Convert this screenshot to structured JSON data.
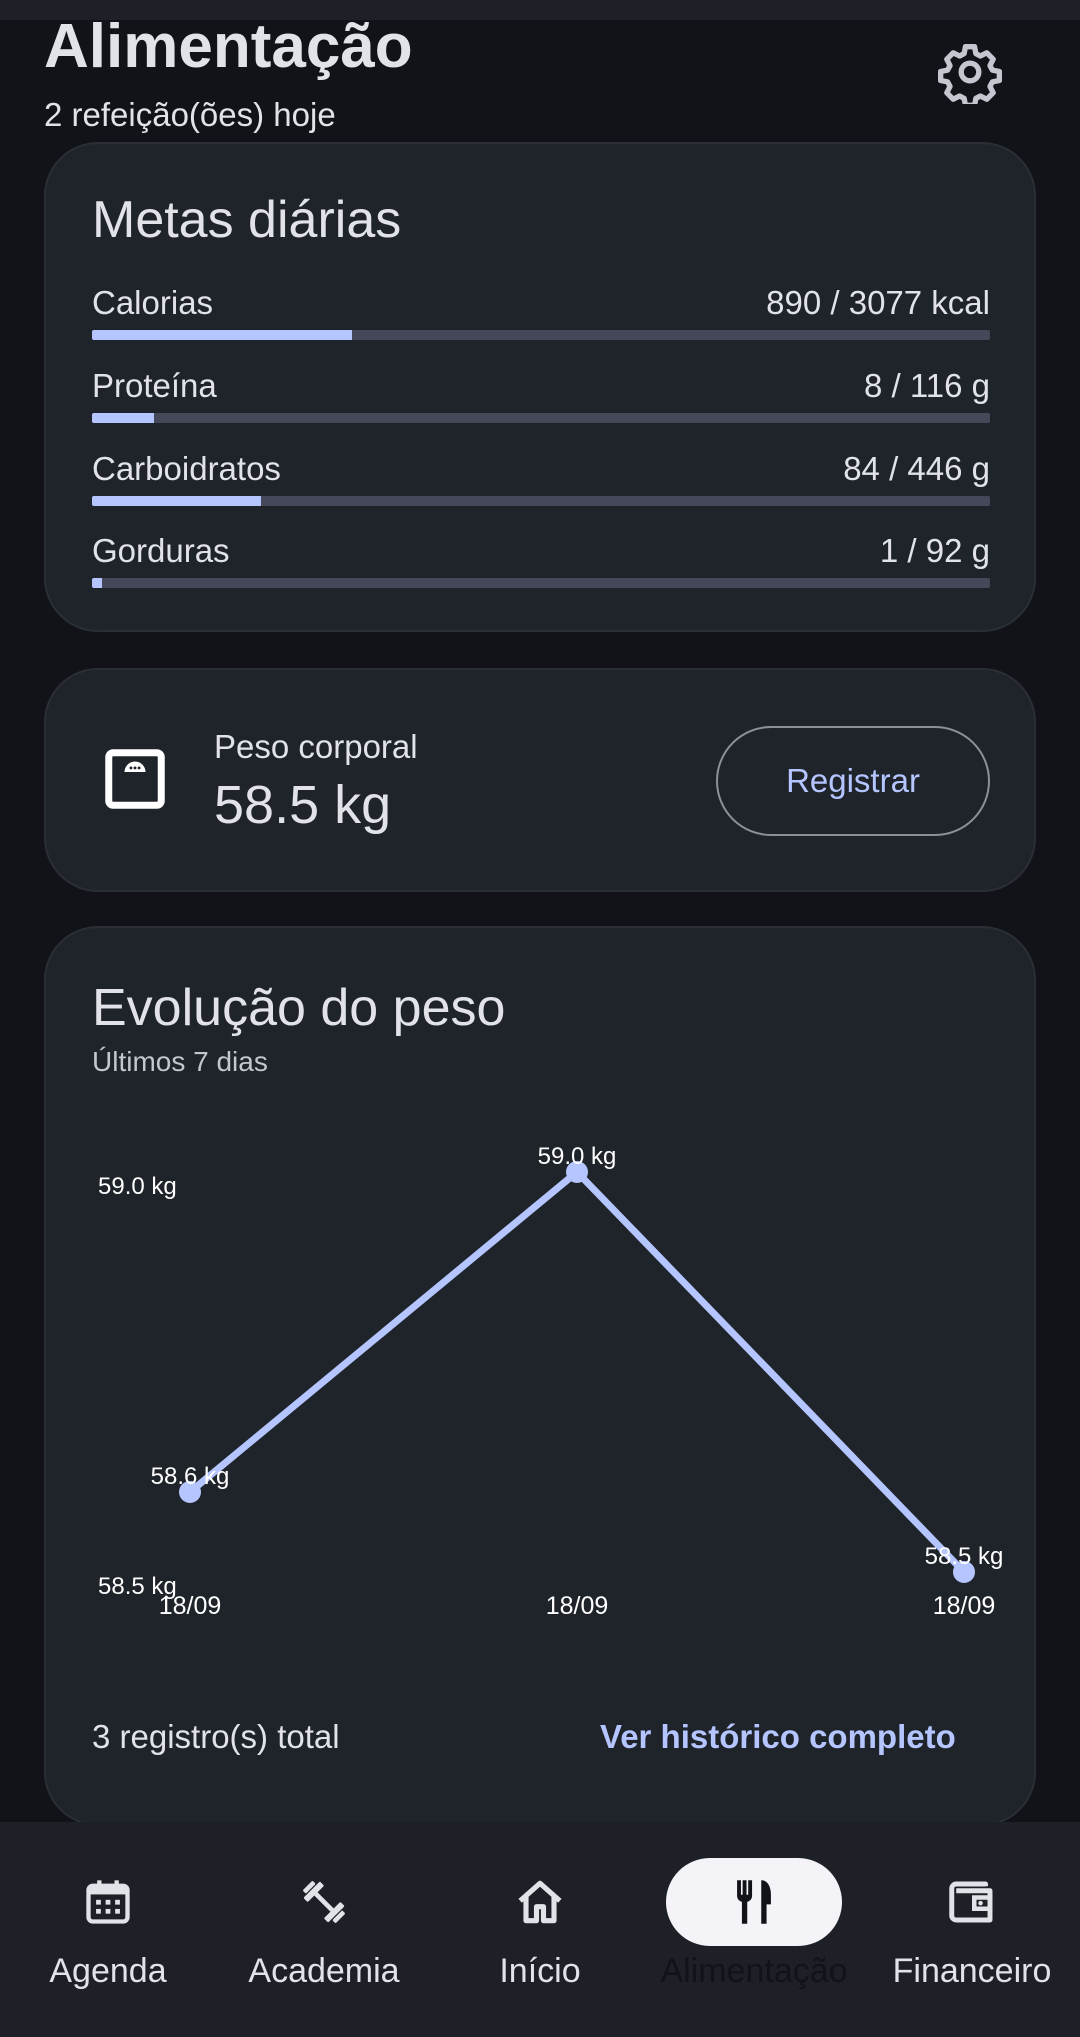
{
  "header": {
    "title": "Alimentação",
    "subtitle": "2 refeição(ões) hoje",
    "settings_icon": "gear-icon"
  },
  "goals": {
    "title": "Metas diárias",
    "items": [
      {
        "label": "Calorias",
        "value": "890 / 3077 kcal",
        "progress": 0.289
      },
      {
        "label": "Proteína",
        "value": "8 / 116 g",
        "progress": 0.069
      },
      {
        "label": "Carboidratos",
        "value": "84 / 446 g",
        "progress": 0.188
      },
      {
        "label": "Gorduras",
        "value": "1 / 92 g",
        "progress": 0.011
      }
    ]
  },
  "weight": {
    "label": "Peso corporal",
    "value": "58.5 kg",
    "register_label": "Registrar",
    "icon": "scale-icon"
  },
  "chart_section": {
    "title": "Evolução do peso",
    "subtitle": "Últimos 7 dias",
    "footer_count": "3 registro(s) total",
    "footer_link": "Ver histórico completo"
  },
  "chart_data": {
    "type": "line",
    "x": [
      "18/09",
      "18/09",
      "18/09"
    ],
    "values": [
      58.6,
      59.0,
      58.5
    ],
    "point_labels": [
      "58.6 kg",
      "59.0 kg",
      "58.5 kg"
    ],
    "y_ticks": [
      "59.0 kg",
      "58.5 kg"
    ],
    "ylim": [
      58.5,
      59.0
    ],
    "line_color": "#b4c5ff",
    "grid": false
  },
  "navbar": {
    "items": [
      {
        "label": "Agenda",
        "icon": "calendar-icon",
        "active": false
      },
      {
        "label": "Academia",
        "icon": "dumbbell-icon",
        "active": false
      },
      {
        "label": "Início",
        "icon": "home-icon",
        "active": false
      },
      {
        "label": "Alimentação",
        "icon": "fork-knife-icon",
        "active": true
      },
      {
        "label": "Financeiro",
        "icon": "wallet-icon",
        "active": false
      }
    ]
  },
  "colors": {
    "background": "#111318",
    "card": "#1f232a",
    "accent": "#b4c5ff",
    "track": "#444858"
  }
}
